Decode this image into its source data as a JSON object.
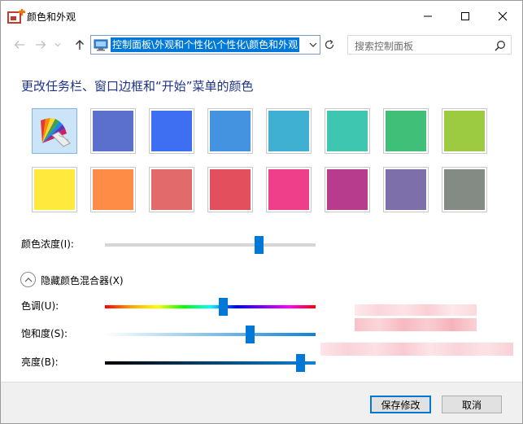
{
  "window": {
    "title": "颜色和外观"
  },
  "navbar": {
    "address": "控制面板\\外观和个性化\\个性化\\颜色和外观",
    "search_placeholder": "搜索控制面板"
  },
  "main": {
    "heading": "更改任务栏、窗口边框和“开始”菜单的颜色",
    "swatches_row1": [
      "custom",
      "#5b6fcc",
      "#3e6ff2",
      "#4493e0",
      "#3fb0d1",
      "#3ec6b0",
      "#3fbf78",
      "#9ccb41"
    ],
    "swatches_row2": [
      "#ffe93d",
      "#ff8c46",
      "#e26a6a",
      "#e44f5e",
      "#f03f8a",
      "#b83c8e",
      "#7d6fa9",
      "#838b84"
    ],
    "intensity_label": "颜色浓度(I):",
    "intensity_value": 0.73,
    "mixer_toggle_label": "隐藏颜色混合器(X)",
    "hue_label": "色调(U):",
    "hue_value": 0.56,
    "saturation_label": "饱和度(S):",
    "saturation_value": 0.69,
    "brightness_label": "亮度(B):",
    "brightness_value": 0.93
  },
  "footer": {
    "save_label": "保存修改",
    "cancel_label": "取消"
  },
  "icons": {
    "app": "personalization-icon",
    "minimize": "minimize-icon",
    "maximize": "maximize-icon",
    "close": "close-icon"
  }
}
